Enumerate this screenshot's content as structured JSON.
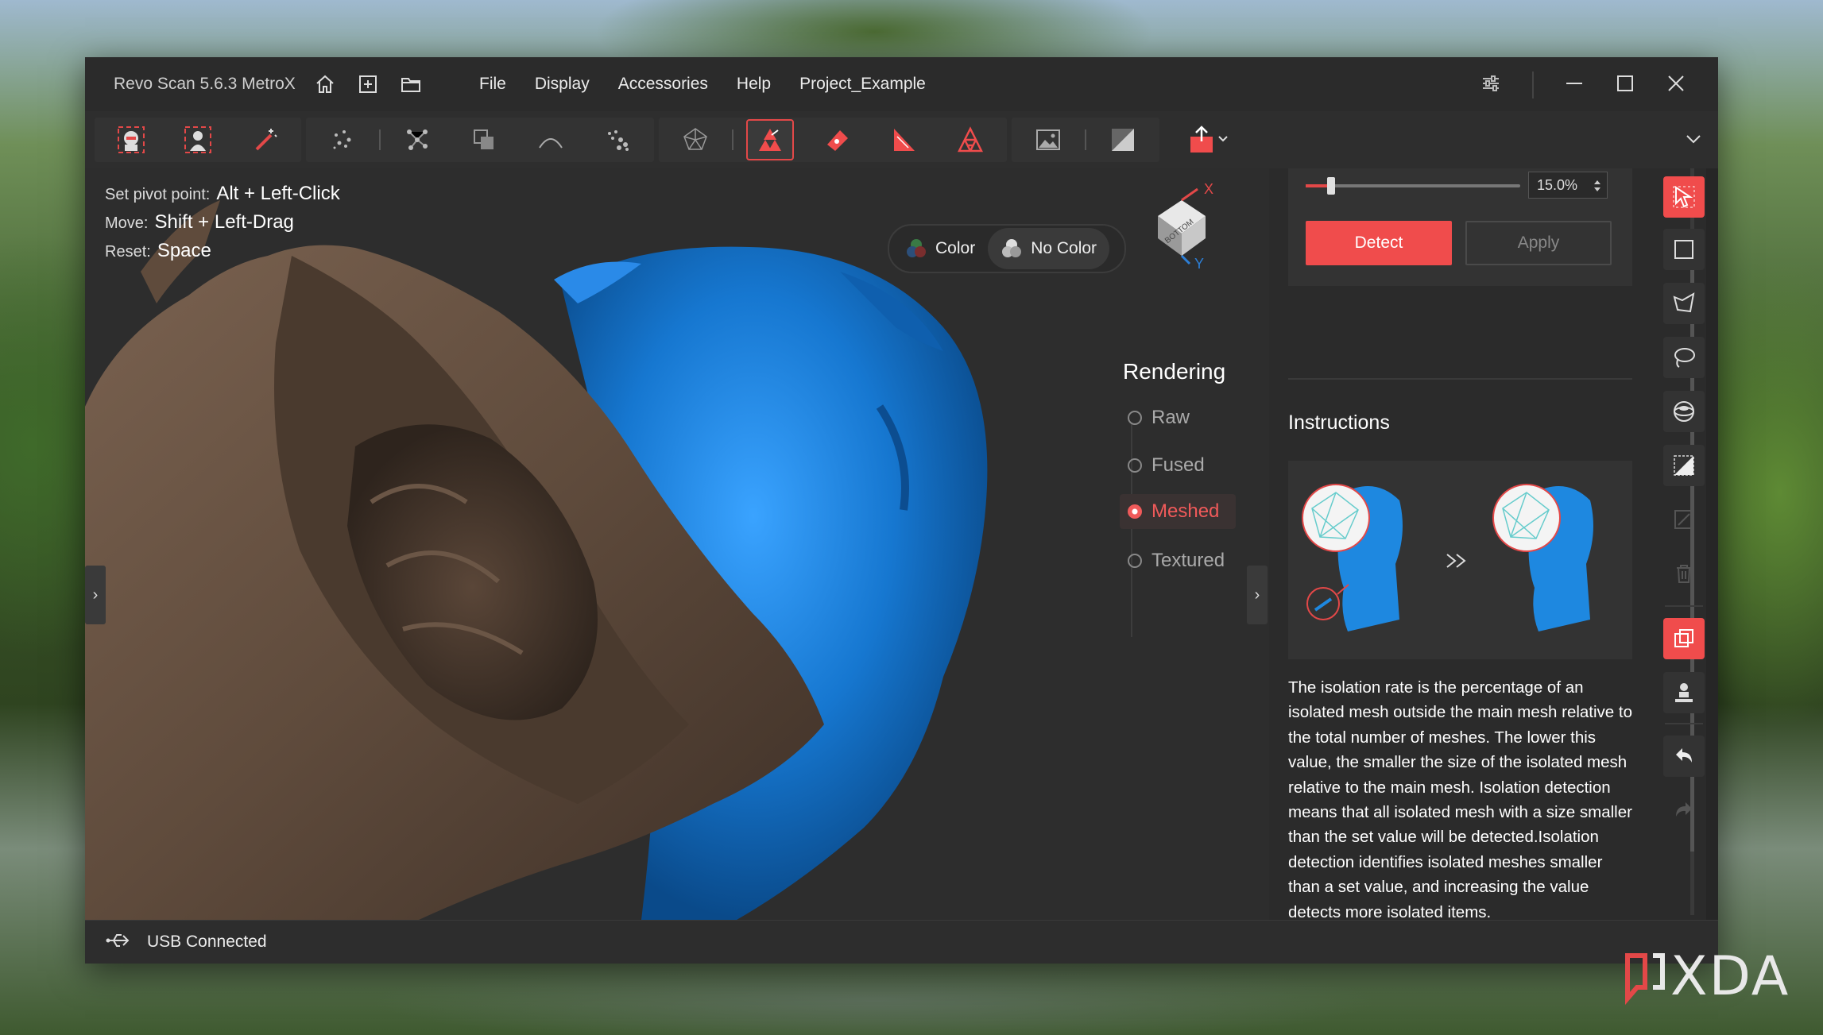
{
  "app": {
    "title": "Revo Scan 5.6.3 MetroX"
  },
  "menu": [
    "File",
    "Display",
    "Accessories",
    "Help",
    "Project_Example"
  ],
  "hints": [
    {
      "label": "Set pivot point:",
      "keys": "Alt + Left-Click"
    },
    {
      "label": "Move:",
      "keys": "Shift + Left-Drag"
    },
    {
      "label": "Reset:",
      "keys": "Space"
    }
  ],
  "color_toggle": {
    "color": "Color",
    "no_color": "No Color",
    "selected": "no_color"
  },
  "axis": {
    "x": "X",
    "y": "Y",
    "face": "BOTTOM"
  },
  "rendering": {
    "title": "Rendering",
    "options": [
      "Raw",
      "Fused",
      "Meshed",
      "Textured"
    ],
    "selected": "Meshed"
  },
  "panel": {
    "isolation_rate": "15.0%",
    "isolation_fraction": 0.12,
    "detect_label": "Detect",
    "apply_label": "Apply",
    "instructions_title": "Instructions",
    "instructions_text": "The isolation rate is the percentage of an isolated mesh outside the main mesh relative to the total number of meshes. The lower this value, the smaller the size of the isolated mesh relative to the main mesh. Isolation detection means that all isolated mesh with a size smaller than the set value will be detected.Isolation detection identifies isolated meshes smaller than a set value, and increasing the value detects more isolated items."
  },
  "status": {
    "text": "USB Connected"
  },
  "watermark": "XDA",
  "colors": {
    "accent": "#f04c4c",
    "mesh_blue": "#1e7fd6",
    "mesh_brown": "#6a5444"
  }
}
